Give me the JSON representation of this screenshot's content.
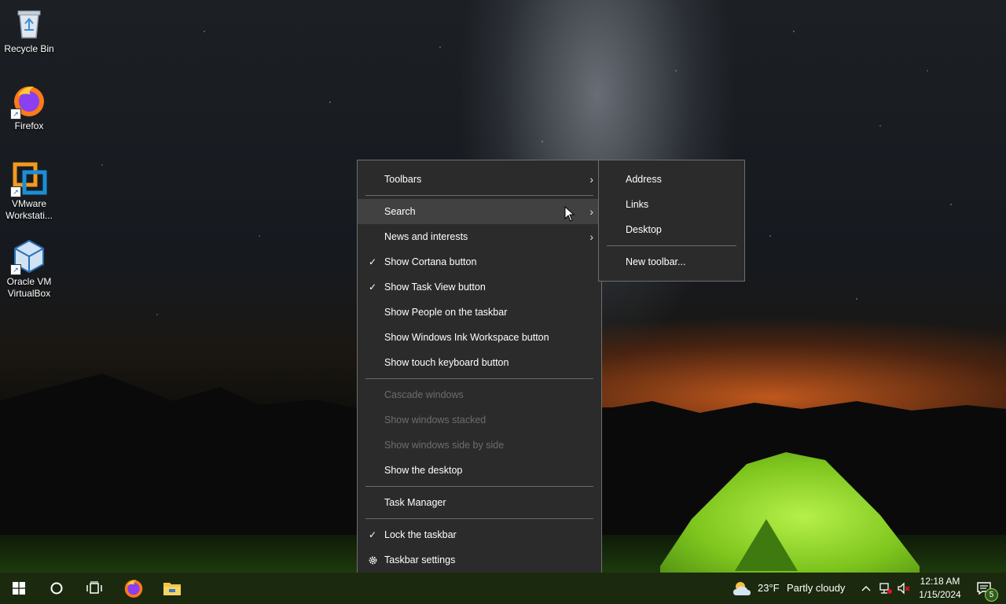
{
  "desktop_icons": [
    {
      "label_line1": "Recycle Bin",
      "label_line2": "",
      "icon": "recycle-bin-icon"
    },
    {
      "label_line1": "Firefox",
      "label_line2": "",
      "icon": "firefox-icon"
    },
    {
      "label_line1": "VMware",
      "label_line2": "Workstati...",
      "icon": "vmware-icon"
    },
    {
      "label_line1": "Oracle VM",
      "label_line2": "VirtualBox",
      "icon": "virtualbox-icon"
    }
  ],
  "context_menu": {
    "items": [
      {
        "label": "Toolbars",
        "checked": false,
        "submenu": true
      },
      {
        "label": "Search",
        "checked": false,
        "submenu": true,
        "highlighted": true
      },
      {
        "label": "News and interests",
        "checked": false,
        "submenu": true
      },
      {
        "label": "Show Cortana button",
        "checked": true
      },
      {
        "label": "Show Task View button",
        "checked": true
      },
      {
        "label": "Show People on the taskbar",
        "checked": false
      },
      {
        "label": "Show Windows Ink Workspace button",
        "checked": false
      },
      {
        "label": "Show touch keyboard button",
        "checked": false
      },
      {
        "label": "Cascade windows",
        "disabled": true
      },
      {
        "label": "Show windows stacked",
        "disabled": true
      },
      {
        "label": "Show windows side by side",
        "disabled": true
      },
      {
        "label": "Show the desktop"
      },
      {
        "label": "Task Manager"
      },
      {
        "label": "Lock the taskbar",
        "checked": true
      },
      {
        "label": "Taskbar settings",
        "icon": "gear-icon"
      }
    ]
  },
  "toolbars_submenu": {
    "items": [
      {
        "label": "Address"
      },
      {
        "label": "Links"
      },
      {
        "label": "Desktop"
      },
      {
        "label": "New toolbar..."
      }
    ]
  },
  "taskbar": {
    "weather_temp": "23°F",
    "weather_desc": "Partly cloudy",
    "time": "12:18 AM",
    "date": "1/15/2024",
    "notification_count": "5"
  },
  "colors": {
    "menu_bg": "#2b2b2b",
    "menu_highlight": "#414141",
    "taskbar_bg": "#1b2a0f",
    "disabled_text": "#6d6d6d"
  }
}
